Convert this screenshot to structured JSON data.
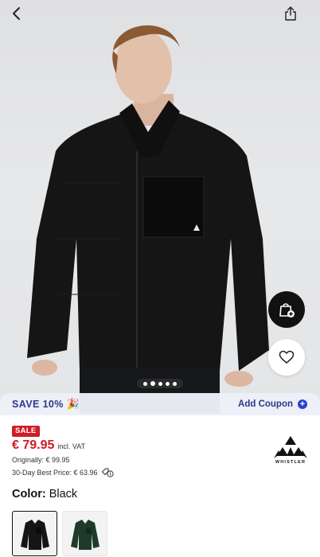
{
  "coupon": {
    "save_text": "SAVE 10%",
    "party_glyph": "🎉",
    "add_label": "Add Coupon"
  },
  "gallery": {
    "image_count": 5,
    "active_index": 1
  },
  "product": {
    "badge": "SALE",
    "price": "€ 79.95",
    "vat": "incl. VAT",
    "original": "Originally: € 99.95",
    "best_price": "30-Day Best Price: € 63.96",
    "brand_name": "WHISTLER",
    "color_label": "Color:",
    "color_value": "Black"
  },
  "colors": {
    "sale_red": "#d01c24",
    "accent_blue": "#2b3fd0",
    "coupon_text": "#2a3a8c"
  }
}
